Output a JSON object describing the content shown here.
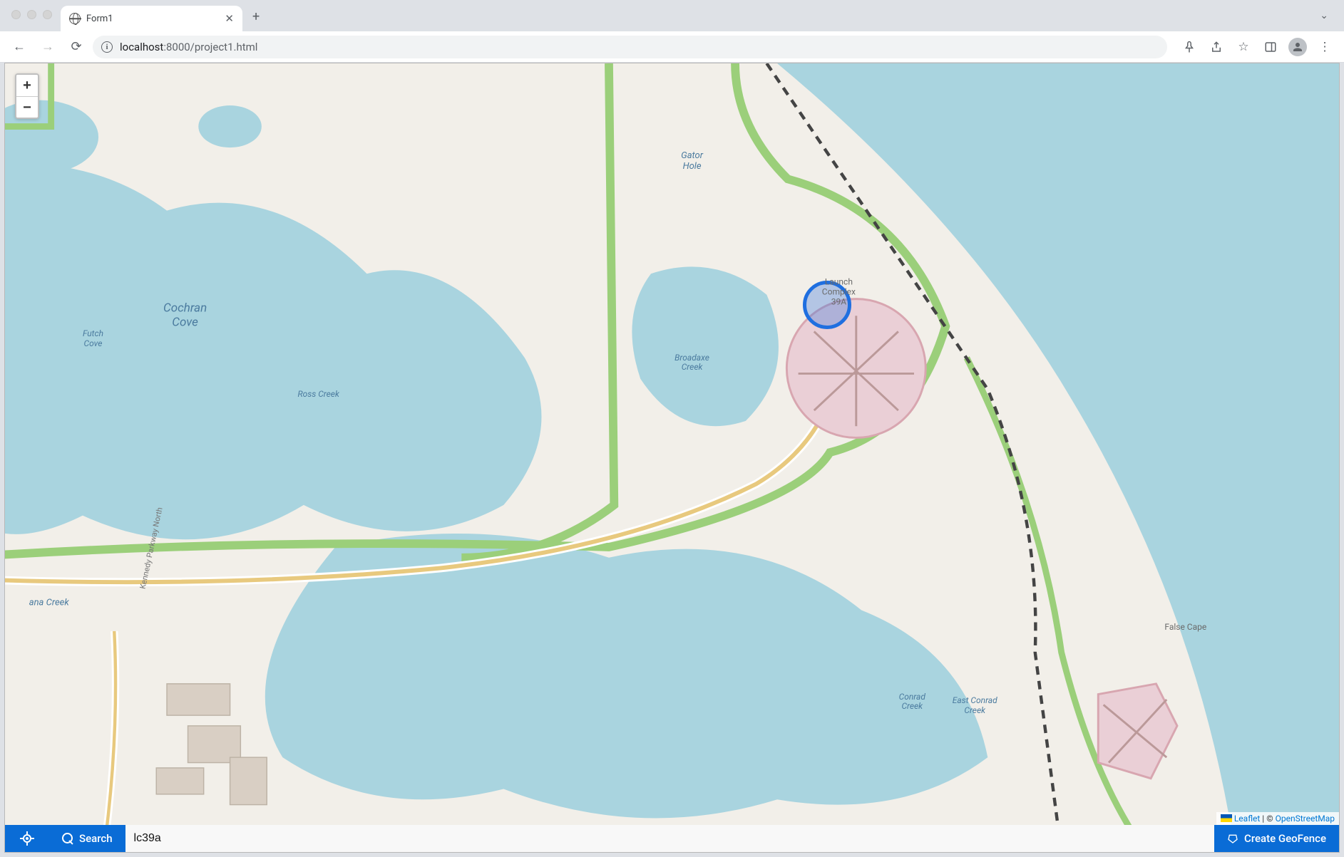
{
  "browser": {
    "tab_title": "Form1",
    "url_host": "localhost",
    "url_port_path": ":8000/project1.html"
  },
  "zoom": {
    "in": "+",
    "out": "−"
  },
  "map_labels": {
    "gator_hole": "Gator\nHole",
    "cochran_cove": "Cochran\nCove",
    "futch_cove": "Futch\nCove",
    "ross_creek": "Ross Creek",
    "broadaxe_creek": "Broadaxe\nCreek",
    "launch_complex": "Launch\nComplex\n39A",
    "false_cape": "False Cape",
    "conrad_creek": "Conrad\nCreek",
    "east_conrad_creek": "East Conrad\nCreek",
    "banana_creek": "ana Creek",
    "kennedy_pkwy": "Kennedy Parkway North"
  },
  "attribution": {
    "leaflet": "Leaflet",
    "sep": " | © ",
    "osm": "OpenStreetMap"
  },
  "bottombar": {
    "search_label": "Search",
    "search_value": "lc39a",
    "geofence_label": "Create GeoFence"
  }
}
